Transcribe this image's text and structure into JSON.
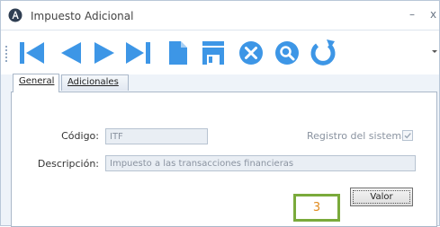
{
  "window": {
    "title": "Impuesto Adicional",
    "minimize_label": "–",
    "close_label": "x"
  },
  "toolbar": {
    "icons": [
      "first-record-icon",
      "previous-record-icon",
      "next-record-icon",
      "last-record-icon",
      "new-document-icon",
      "save-icon",
      "cancel-icon",
      "search-icon",
      "refresh-icon"
    ],
    "accent_color": "#3d96e6"
  },
  "tabs": [
    {
      "label": "General",
      "active": true
    },
    {
      "label": "Adicionales",
      "active": false
    }
  ],
  "form": {
    "codigo_label": "Código:",
    "codigo_value": "ITF",
    "descripcion_label": "Descripción:",
    "descripcion_value": "Impuesto a las transacciones financieras",
    "registro_label": "Registro del sistema",
    "registro_checked": true
  },
  "annotation": {
    "number": "3",
    "border_color": "#7aaa3b",
    "text_color": "#e08a1e"
  },
  "buttons": {
    "valor_label": "Valor"
  }
}
